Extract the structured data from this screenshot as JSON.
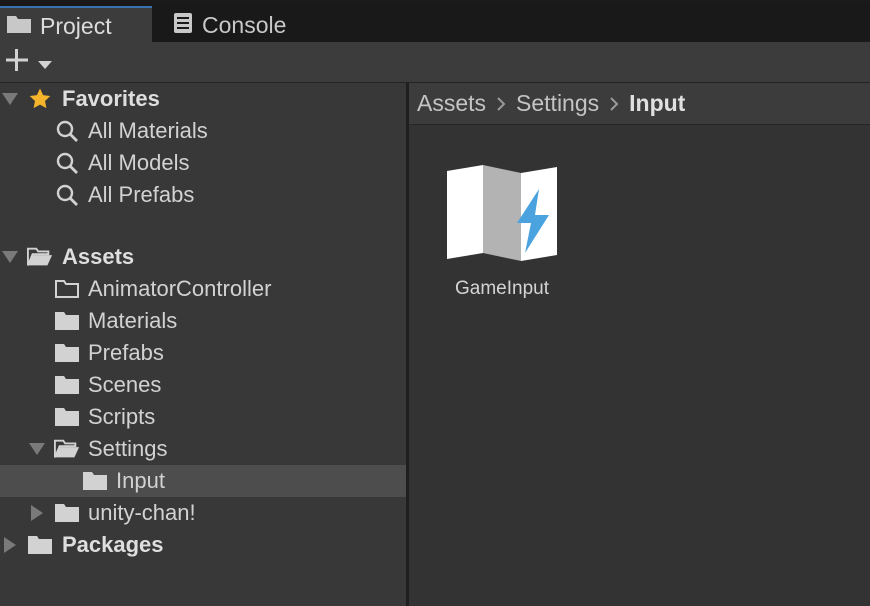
{
  "tabs": [
    {
      "label": "Project",
      "icon": "folder-icon",
      "active": true
    },
    {
      "label": "Console",
      "icon": "console-icon",
      "active": false
    }
  ],
  "toolbar": {
    "add_icon": "plus-icon",
    "dropdown_icon": "caret-down-icon"
  },
  "tree": {
    "favorites": {
      "label": "Favorites",
      "icon": "star-icon",
      "items": [
        {
          "label": "All Materials",
          "icon": "search-icon"
        },
        {
          "label": "All Models",
          "icon": "search-icon"
        },
        {
          "label": "All Prefabs",
          "icon": "search-icon"
        }
      ]
    },
    "assets": {
      "label": "Assets",
      "icon": "folder-open-icon",
      "items": [
        {
          "label": "AnimatorController",
          "icon": "folder-empty-icon"
        },
        {
          "label": "Materials",
          "icon": "folder-icon"
        },
        {
          "label": "Prefabs",
          "icon": "folder-icon"
        },
        {
          "label": "Scenes",
          "icon": "folder-icon"
        },
        {
          "label": "Scripts",
          "icon": "folder-icon"
        },
        {
          "label": "Settings",
          "icon": "folder-open-icon",
          "expanded": true
        },
        {
          "label": "Input",
          "icon": "folder-icon",
          "selected": true
        },
        {
          "label": "unity-chan!",
          "icon": "folder-icon",
          "expanded": false
        }
      ]
    },
    "packages": {
      "label": "Packages",
      "icon": "folder-icon",
      "expanded": false
    }
  },
  "breadcrumb": [
    "Assets",
    "Settings",
    "Input"
  ],
  "assets_view": {
    "items": [
      {
        "label": "GameInput",
        "icon": "input-actions-icon"
      }
    ]
  },
  "colors": {
    "accent": "#3a72b0",
    "star": "#f4b52c",
    "bolt": "#4aa3df",
    "selected_row": "#4d4d4d"
  }
}
